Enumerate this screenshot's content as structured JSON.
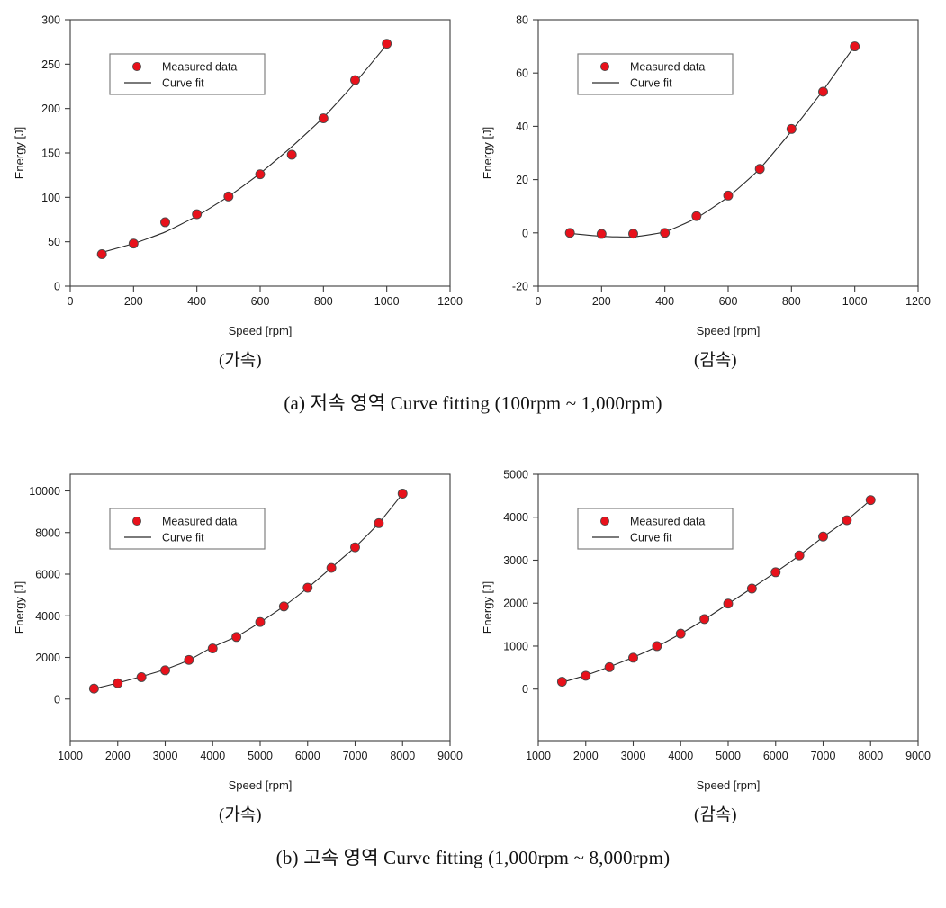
{
  "figure": {
    "panels": [
      {
        "id": "a",
        "caption": "(a) 저속 영역 Curve fitting (100rpm ~ 1,000rpm)",
        "left_sub_label": "(가속)",
        "right_sub_label": "(감속)"
      },
      {
        "id": "b",
        "caption": "(b) 고속 영역 Curve fitting (1,000rpm ~ 8,000rpm)",
        "left_sub_label": "(가속)",
        "right_sub_label": "(감속)"
      }
    ]
  },
  "legend": {
    "measured_label": "Measured data",
    "fit_label": "Curve fit"
  },
  "colors": {
    "marker_fill": "#e8111b",
    "marker_edge": "#4a4a4a",
    "line": "#2b2b2b",
    "axis": "#3c3c3c",
    "text": "#1a1a1a",
    "legend_border": "#808080"
  },
  "chart_data": [
    {
      "id": "accel-low",
      "type": "scatter",
      "title": "",
      "xlabel": "Speed [rpm]",
      "ylabel": "Energy [J]",
      "xlim": [
        0,
        1200
      ],
      "ylim": [
        0,
        300
      ],
      "xticks": [
        0,
        200,
        400,
        600,
        800,
        1000,
        1200
      ],
      "yticks": [
        0,
        50,
        100,
        150,
        200,
        250,
        300
      ],
      "grid": false,
      "legend": [
        "Measured data",
        "Curve fit"
      ],
      "legend_position": "upper-left",
      "x": [
        100,
        200,
        300,
        400,
        500,
        600,
        700,
        800,
        900,
        1000
      ],
      "values": [
        36,
        48,
        72,
        81,
        101,
        126,
        148,
        189,
        232,
        273
      ],
      "series": [
        {
          "name": "Measured data",
          "x": [
            100,
            200,
            300,
            400,
            500,
            600,
            700,
            800,
            900,
            1000
          ],
          "values": [
            36,
            48,
            72,
            81,
            101,
            126,
            148,
            189,
            232,
            273
          ]
        },
        {
          "name": "Curve fit",
          "x": [
            100,
            200,
            300,
            400,
            500,
            600,
            700,
            800,
            900,
            1000
          ],
          "values": [
            38,
            48,
            61,
            79,
            101,
            127,
            157,
            190,
            229,
            272
          ]
        }
      ]
    },
    {
      "id": "decel-low",
      "type": "scatter",
      "title": "",
      "xlabel": "Speed [rpm]",
      "ylabel": "Energy [J]",
      "xlim": [
        0,
        1200
      ],
      "ylim": [
        -20,
        80
      ],
      "xticks": [
        0,
        200,
        400,
        600,
        800,
        1000,
        1200
      ],
      "yticks": [
        -20,
        0,
        20,
        40,
        60,
        80
      ],
      "grid": false,
      "legend": [
        "Measured data",
        "Curve fit"
      ],
      "legend_position": "upper-left",
      "x": [
        100,
        200,
        300,
        400,
        500,
        600,
        700,
        800,
        900,
        1000
      ],
      "values": [
        0,
        -0.4,
        -0.3,
        0,
        6.3,
        14,
        24,
        39,
        53,
        70
      ],
      "series": [
        {
          "name": "Measured data",
          "x": [
            100,
            200,
            300,
            400,
            500,
            600,
            700,
            800,
            900,
            1000
          ],
          "values": [
            0,
            -0.4,
            -0.3,
            0,
            6.3,
            14,
            24,
            39,
            53,
            70
          ]
        },
        {
          "name": "Curve fit",
          "x": [
            100,
            200,
            300,
            400,
            500,
            600,
            700,
            800,
            900,
            1000
          ],
          "values": [
            -0.2,
            -1.3,
            -1.5,
            0.4,
            5.6,
            13.5,
            24.1,
            38.2,
            53.5,
            70.2
          ]
        }
      ]
    },
    {
      "id": "accel-high",
      "type": "scatter",
      "title": "",
      "xlabel": "Speed [rpm]",
      "ylabel": "Energy [J]",
      "xlim": [
        1000,
        9000
      ],
      "ylim": [
        -2000,
        10800
      ],
      "xticks": [
        1000,
        2000,
        3000,
        4000,
        5000,
        6000,
        7000,
        8000,
        9000
      ],
      "yticks": [
        0,
        2000,
        4000,
        6000,
        8000,
        10000
      ],
      "grid": false,
      "legend": [
        "Measured data",
        "Curve fit"
      ],
      "legend_position": "upper-left",
      "x": [
        1500,
        2000,
        2500,
        3000,
        3500,
        4000,
        4500,
        5000,
        5500,
        6000,
        6500,
        7000,
        7500,
        8000
      ],
      "values": [
        500,
        760,
        1050,
        1380,
        1880,
        2430,
        2980,
        3700,
        4450,
        5350,
        6300,
        7290,
        8450,
        9870
      ],
      "series": [
        {
          "name": "Measured data",
          "x": [
            1500,
            2000,
            2500,
            3000,
            3500,
            4000,
            4500,
            5000,
            5500,
            6000,
            6500,
            7000,
            7500,
            8000
          ],
          "values": [
            500,
            760,
            1050,
            1380,
            1880,
            2430,
            2980,
            3700,
            4450,
            5350,
            6300,
            7290,
            8450,
            9870
          ]
        },
        {
          "name": "Curve fit",
          "x": [
            1500,
            2000,
            2500,
            3000,
            3500,
            4000,
            4500,
            5000,
            5500,
            6000,
            6500,
            7000,
            7500,
            8000
          ],
          "values": [
            490,
            770,
            1080,
            1420,
            1870,
            2500,
            3000,
            3690,
            4460,
            5340,
            6310,
            7300,
            8450,
            9870
          ]
        }
      ]
    },
    {
      "id": "decel-high",
      "type": "scatter",
      "title": "",
      "xlabel": "Speed [rpm]",
      "ylabel": "Energy [J]",
      "xlim": [
        1000,
        9000
      ],
      "ylim": [
        -1200,
        5000
      ],
      "xticks": [
        1000,
        2000,
        3000,
        4000,
        5000,
        6000,
        7000,
        8000,
        9000
      ],
      "yticks": [
        0,
        1000,
        2000,
        3000,
        4000,
        5000
      ],
      "grid": false,
      "legend": [
        "Measured data",
        "Curve fit"
      ],
      "legend_position": "upper-left",
      "x": [
        1500,
        2000,
        2500,
        3000,
        3500,
        4000,
        4500,
        5000,
        5500,
        6000,
        6500,
        7000,
        7500,
        8000
      ],
      "values": [
        170,
        310,
        510,
        730,
        1000,
        1290,
        1630,
        1990,
        2340,
        2720,
        3110,
        3550,
        3930,
        4400
      ],
      "series": [
        {
          "name": "Measured data",
          "x": [
            1500,
            2000,
            2500,
            3000,
            3500,
            4000,
            4500,
            5000,
            5500,
            6000,
            6500,
            7000,
            7500,
            8000
          ],
          "values": [
            170,
            310,
            510,
            730,
            1000,
            1290,
            1630,
            1990,
            2340,
            2720,
            3110,
            3550,
            3930,
            4400
          ]
        },
        {
          "name": "Curve fit",
          "x": [
            1500,
            2000,
            2500,
            3000,
            3500,
            4000,
            4500,
            5000,
            5500,
            6000,
            6500,
            7000,
            7500,
            8000
          ],
          "values": [
            155,
            320,
            520,
            740,
            990,
            1290,
            1620,
            1985,
            2350,
            2720,
            3110,
            3540,
            3935,
            4400
          ]
        }
      ]
    }
  ]
}
